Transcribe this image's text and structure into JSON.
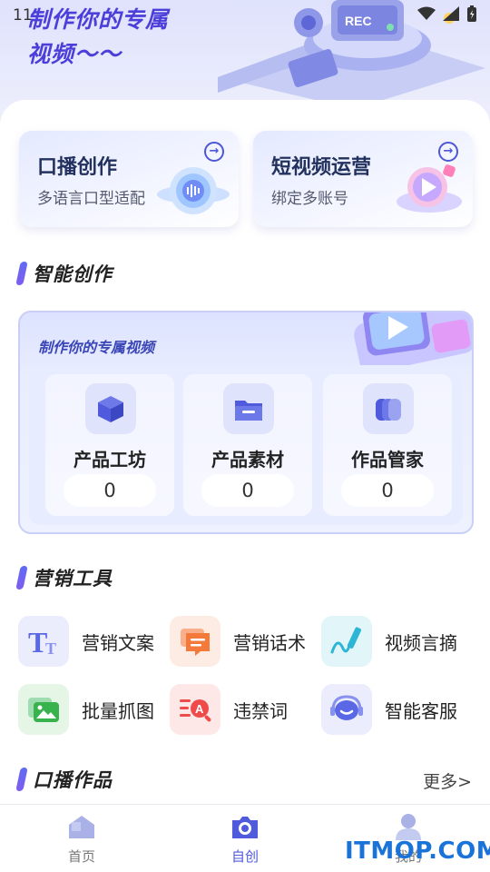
{
  "status_bar": {
    "time": "11"
  },
  "hero": {
    "title_line1": "制作你的专属",
    "title_line2": "视频～～"
  },
  "top_cards": [
    {
      "title": "口播创作",
      "subtitle": "多语言口型适配"
    },
    {
      "title": "短视频运营",
      "subtitle": "绑定多账号"
    }
  ],
  "sections": {
    "smart": "智能创作",
    "marketing": "营销工具",
    "works": "口播作品",
    "works_more": "更多>"
  },
  "smart_card": {
    "subtitle": "制作你的专属视频",
    "tiles": [
      {
        "label": "产品工坊",
        "count": "0",
        "icon": "cube-icon"
      },
      {
        "label": "产品素材",
        "count": "0",
        "icon": "folder-icon"
      },
      {
        "label": "作品管家",
        "count": "0",
        "icon": "stack-icon"
      }
    ]
  },
  "tools": [
    {
      "label": "营销文案",
      "icon": "text-icon",
      "color": "#5b68e6"
    },
    {
      "label": "营销话术",
      "icon": "speech-icon",
      "color": "#f47a3c"
    },
    {
      "label": "视频言摘",
      "icon": "pen-icon",
      "color": "#2db5d6"
    },
    {
      "label": "批量抓图",
      "icon": "image-icon",
      "color": "#37b24d"
    },
    {
      "label": "违禁词",
      "icon": "search-text-icon",
      "color": "#ef4b4b"
    },
    {
      "label": "智能客服",
      "icon": "headset-icon",
      "color": "#5b68e6"
    }
  ],
  "tabbar": [
    {
      "label": "首页",
      "icon": "home-icon"
    },
    {
      "label": "自创",
      "icon": "camera-icon"
    },
    {
      "label": "我的",
      "icon": "user-icon"
    }
  ],
  "watermark": "ITMOP.COM",
  "colors": {
    "accent": "#4d56d8",
    "brand_purple": "#4c3fd9",
    "tab_active": "#4f5bdc",
    "tab_inactive": "#777777"
  }
}
